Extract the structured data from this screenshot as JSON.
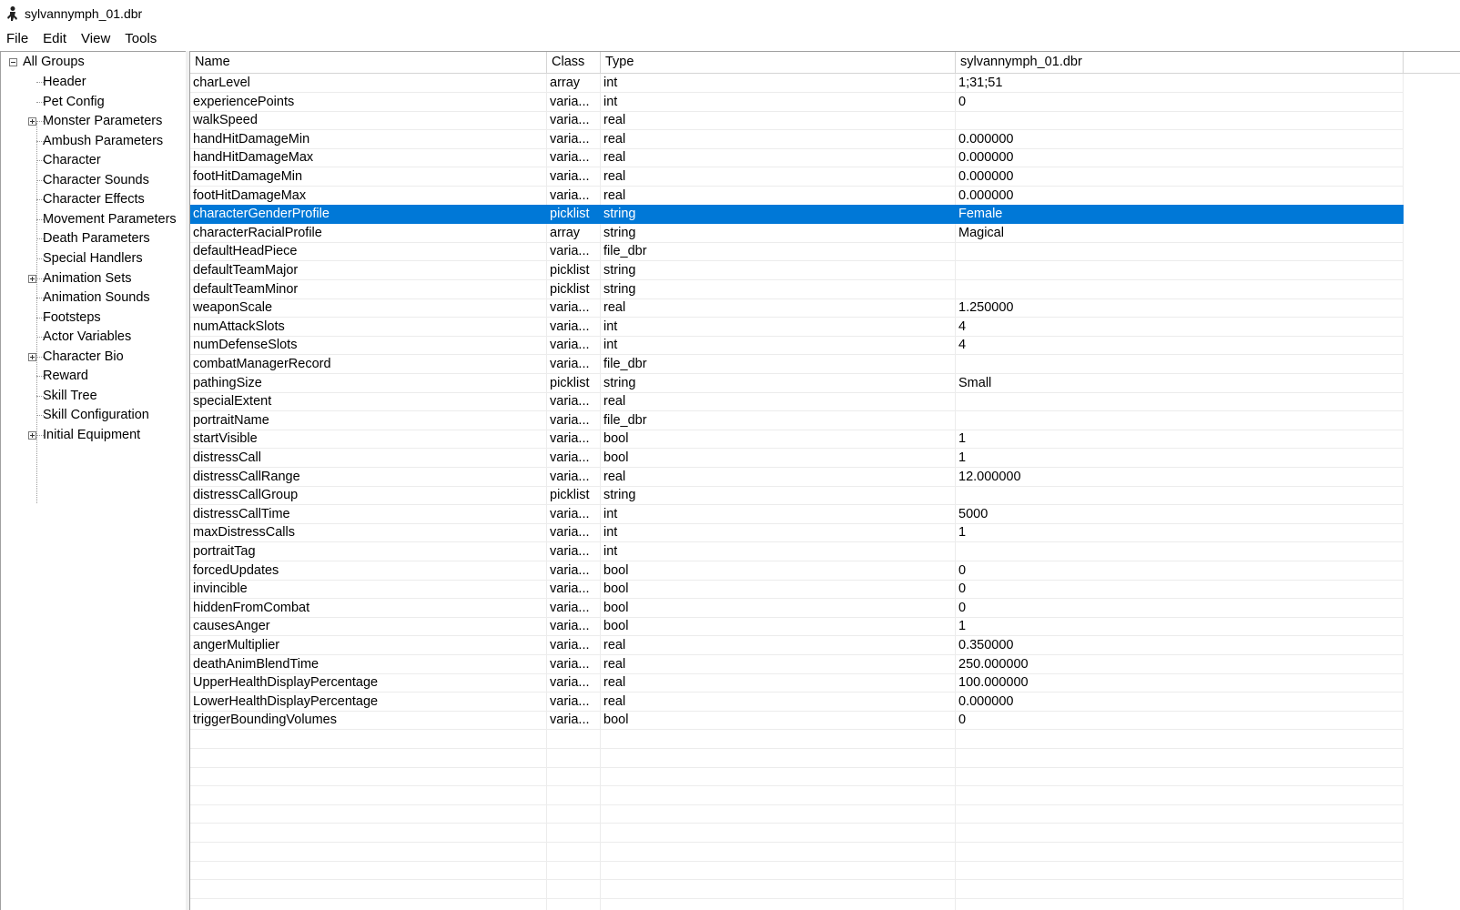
{
  "window": {
    "title": "sylvannymph_01.dbr"
  },
  "menu": [
    "File",
    "Edit",
    "View",
    "Tools"
  ],
  "tree": {
    "root": {
      "label": "All Groups",
      "expanded": true
    },
    "items": [
      {
        "label": "Header",
        "expandable": false
      },
      {
        "label": "Pet Config",
        "expandable": false
      },
      {
        "label": "Monster Parameters",
        "expandable": true
      },
      {
        "label": "Ambush Parameters",
        "expandable": false
      },
      {
        "label": "Character",
        "expandable": false
      },
      {
        "label": "Character Sounds",
        "expandable": false
      },
      {
        "label": "Character Effects",
        "expandable": false
      },
      {
        "label": "Movement Parameters",
        "expandable": false
      },
      {
        "label": "Death Parameters",
        "expandable": false
      },
      {
        "label": "Special Handlers",
        "expandable": false
      },
      {
        "label": "Animation Sets",
        "expandable": true
      },
      {
        "label": "Animation Sounds",
        "expandable": false
      },
      {
        "label": "Footsteps",
        "expandable": false
      },
      {
        "label": "Actor Variables",
        "expandable": false
      },
      {
        "label": "Character Bio",
        "expandable": true
      },
      {
        "label": "Reward",
        "expandable": false
      },
      {
        "label": "Skill Tree",
        "expandable": false
      },
      {
        "label": "Skill Configuration",
        "expandable": false
      },
      {
        "label": "Initial Equipment",
        "expandable": true
      }
    ]
  },
  "grid": {
    "columns": [
      "Name",
      "Class",
      "Type",
      "sylvannymph_01.dbr"
    ],
    "selected_row": "characterGenderProfile",
    "selection_color": "#0078d7",
    "rows": [
      [
        "charLevel",
        "array",
        "int",
        "1;31;51"
      ],
      [
        "experiencePoints",
        "varia...",
        "int",
        "0"
      ],
      [
        "walkSpeed",
        "varia...",
        "real",
        ""
      ],
      [
        "handHitDamageMin",
        "varia...",
        "real",
        "0.000000"
      ],
      [
        "handHitDamageMax",
        "varia...",
        "real",
        "0.000000"
      ],
      [
        "footHitDamageMin",
        "varia...",
        "real",
        "0.000000"
      ],
      [
        "footHitDamageMax",
        "varia...",
        "real",
        "0.000000"
      ],
      [
        "characterGenderProfile",
        "picklist",
        "string",
        "Female"
      ],
      [
        "characterRacialProfile",
        "array",
        "string",
        "Magical"
      ],
      [
        "defaultHeadPiece",
        "varia...",
        "file_dbr",
        ""
      ],
      [
        "defaultTeamMajor",
        "picklist",
        "string",
        ""
      ],
      [
        "defaultTeamMinor",
        "picklist",
        "string",
        ""
      ],
      [
        "weaponScale",
        "varia...",
        "real",
        "1.250000"
      ],
      [
        "numAttackSlots",
        "varia...",
        "int",
        "4"
      ],
      [
        "numDefenseSlots",
        "varia...",
        "int",
        "4"
      ],
      [
        "combatManagerRecord",
        "varia...",
        "file_dbr",
        ""
      ],
      [
        "pathingSize",
        "picklist",
        "string",
        "Small"
      ],
      [
        "specialExtent",
        "varia...",
        "real",
        ""
      ],
      [
        "portraitName",
        "varia...",
        "file_dbr",
        ""
      ],
      [
        "startVisible",
        "varia...",
        "bool",
        "1"
      ],
      [
        "distressCall",
        "varia...",
        "bool",
        "1"
      ],
      [
        "distressCallRange",
        "varia...",
        "real",
        "12.000000"
      ],
      [
        "distressCallGroup",
        "picklist",
        "string",
        ""
      ],
      [
        "distressCallTime",
        "varia...",
        "int",
        "5000"
      ],
      [
        "maxDistressCalls",
        "varia...",
        "int",
        "1"
      ],
      [
        "portraitTag",
        "varia...",
        "int",
        ""
      ],
      [
        "forcedUpdates",
        "varia...",
        "bool",
        "0"
      ],
      [
        "invincible",
        "varia...",
        "bool",
        "0"
      ],
      [
        "hiddenFromCombat",
        "varia...",
        "bool",
        "0"
      ],
      [
        "causesAnger",
        "varia...",
        "bool",
        "1"
      ],
      [
        "angerMultiplier",
        "varia...",
        "real",
        "0.350000"
      ],
      [
        "deathAnimBlendTime",
        "varia...",
        "real",
        "250.000000"
      ],
      [
        "UpperHealthDisplayPercentage",
        "varia...",
        "real",
        "100.000000"
      ],
      [
        "LowerHealthDisplayPercentage",
        "varia...",
        "real",
        "0.000000"
      ],
      [
        "triggerBoundingVolumes",
        "varia...",
        "bool",
        "0"
      ]
    ]
  }
}
